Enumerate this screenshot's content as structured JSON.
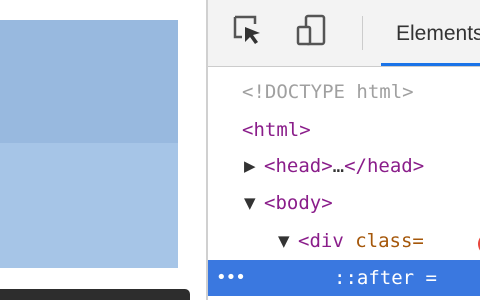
{
  "devtools": {
    "toolbar": {
      "inspect_icon": "inspect-cursor-icon",
      "device_icon": "device-toggle-icon",
      "active_tab": "Elements"
    },
    "dom": {
      "doctype": "<!DOCTYPE html>",
      "html_open": "<html>",
      "head_open": "<head>",
      "head_ellipsis": "…",
      "head_close": "</head>",
      "body_open": "<body>",
      "div_open": "<div",
      "div_attr": "class=",
      "after_pseudo": "::after",
      "after_eq": "=",
      "row_menu": "•••"
    },
    "colors": {
      "accent": "#1a73e8",
      "selection": "#3a78e0",
      "tag": "#8a1d8a",
      "attr": "#a5570a",
      "badge": "#e8453c"
    }
  },
  "page_preview": {
    "top_block_color": "#98b9df",
    "bottom_block_color": "#a6c5e7"
  }
}
